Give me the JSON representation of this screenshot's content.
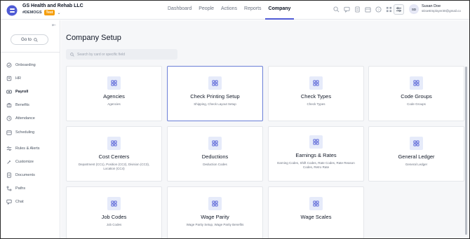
{
  "header": {
    "company_name": "GS Health and Rehab LLC",
    "company_code": "#DEMOGS",
    "badge": "Test",
    "nav": [
      "Dashboard",
      "People",
      "Actions",
      "Reports",
      "Company"
    ],
    "active_nav": "Company",
    "tools": [
      "search-icon",
      "chat-icon",
      "document-icon",
      "calendar-icon",
      "help-icon",
      "grid-icon"
    ],
    "user": {
      "initials": "SD",
      "name": "Susan Doe",
      "email": "sDoeEmployer30@gmail.co"
    }
  },
  "sidebar": {
    "goto_label": "Go to",
    "items": [
      {
        "label": "Onboarding",
        "icon": "onboarding-icon"
      },
      {
        "label": "HR",
        "icon": "hr-icon"
      },
      {
        "label": "Payroll",
        "icon": "payroll-icon",
        "active": true
      },
      {
        "label": "Benefits",
        "icon": "benefits-icon"
      },
      {
        "label": "Attendance",
        "icon": "attendance-icon"
      },
      {
        "label": "Scheduling",
        "icon": "scheduling-icon"
      },
      {
        "label": "Rules & Alerts",
        "icon": "rules-icon"
      },
      {
        "label": "Customize",
        "icon": "customize-icon"
      },
      {
        "label": "Documents",
        "icon": "documents-icon"
      },
      {
        "label": "Paths",
        "icon": "paths-icon"
      },
      {
        "label": "Chat",
        "icon": "chat-icon"
      }
    ]
  },
  "main": {
    "title": "Company Setup",
    "search_placeholder": "Search by card or specific field",
    "cards": [
      {
        "title": "Agencies",
        "desc": "Agencies"
      },
      {
        "title": "Check Printing Setup",
        "desc": "Shipping, Check Layout Setup",
        "selected": true
      },
      {
        "title": "Check Types",
        "desc": "Check Types"
      },
      {
        "title": "Code Groups",
        "desc": "Code Groups"
      },
      {
        "title": "Cost Centers",
        "desc": "Department (CC1), Position (CC2), Division (CC3), Location (CC4)"
      },
      {
        "title": "Deductions",
        "desc": "Deduction Codes"
      },
      {
        "title": "Earnings & Rates",
        "desc": "Earning Codes, Shift Codes, Rate Codes, Rate Reason Codes, Retro Rate"
      },
      {
        "title": "General Ledger",
        "desc": "General Ledger"
      },
      {
        "title": "Job Codes",
        "desc": "Job Codes"
      },
      {
        "title": "Wage Parity",
        "desc": "Wage Parity Setup, Wage Parity Benefits"
      },
      {
        "title": "Wage Scales",
        "desc": ""
      }
    ]
  },
  "colors": {
    "accent": "#4f5bd5",
    "badge": "#f59e0b",
    "card_icon_bg": "#e6ebfa"
  }
}
